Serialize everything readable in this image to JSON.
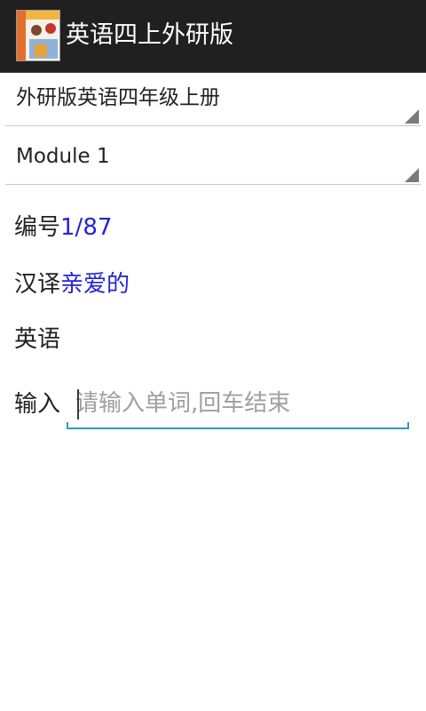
{
  "app": {
    "title": "英语四上外研版",
    "icon": "textbook-cover-icon"
  },
  "spinners": {
    "book": {
      "selected": "外研版英语四年级上册"
    },
    "module": {
      "selected": "Module 1"
    }
  },
  "rows": {
    "number": {
      "label": "编号",
      "value": "1/87"
    },
    "chinese": {
      "label": "汉译",
      "value": "亲爱的"
    },
    "english": {
      "label": "英语",
      "value": ""
    }
  },
  "input": {
    "label": "输入",
    "value": "",
    "placeholder": "请输入单词,回车结束"
  },
  "colors": {
    "action_bar": "#202020",
    "value_text": "#2424d6",
    "input_accent": "#2a9bd0"
  }
}
